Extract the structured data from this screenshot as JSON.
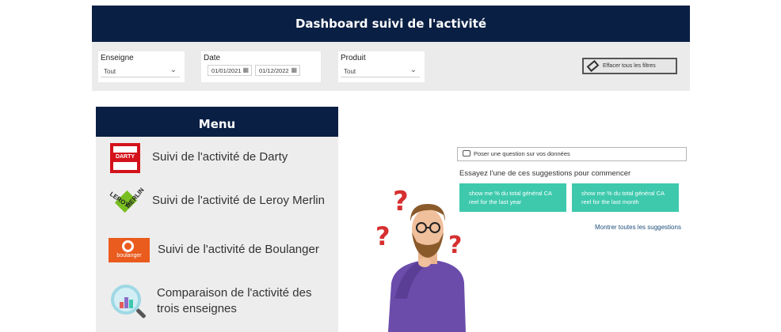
{
  "header": {
    "title": "Dashboard suivi de l'activité"
  },
  "filters": {
    "enseigne": {
      "label": "Enseigne",
      "value": "Tout"
    },
    "date": {
      "label": "Date",
      "start": "01/01/2021",
      "end": "01/12/2022"
    },
    "produit": {
      "label": "Produit",
      "value": "Tout"
    },
    "clear_label": "Effacer tous les filtres"
  },
  "menu": {
    "title": "Menu",
    "items": [
      {
        "label": "Suivi de l'activité de Darty",
        "logo": "DARTY"
      },
      {
        "label": "Suivi de l'activité de Leroy Merlin",
        "logo_a": "LEROY",
        "logo_b": "MERLIN"
      },
      {
        "label": "Suivi de l'activité de Boulanger",
        "logo": "boulanger"
      },
      {
        "label": "Comparaison de l'activité des trois enseignes"
      }
    ]
  },
  "qa": {
    "placeholder": "Poser une question sur vos données",
    "suggestions_title": "Essayez l'une de ces suggestions pour commencer",
    "suggestions": [
      {
        "line1": "show me % du total général CA",
        "line2": "reel for the last year"
      },
      {
        "line1": "show me % du total général CA",
        "line2": "reel for the last month"
      }
    ],
    "show_all": "Montrer toutes les suggestions"
  },
  "colors": {
    "navy": "#0a1f44",
    "teal": "#3ec9ad",
    "darty_red": "#d4121b",
    "boulanger_orange": "#ea5b1e",
    "leroy_green": "#78be20"
  },
  "icons": [
    "calendar-icon",
    "chevron-down-icon",
    "eraser-icon",
    "chat-bubble-icon",
    "magnifier-chart-icon",
    "thinking-man-illustration"
  ]
}
